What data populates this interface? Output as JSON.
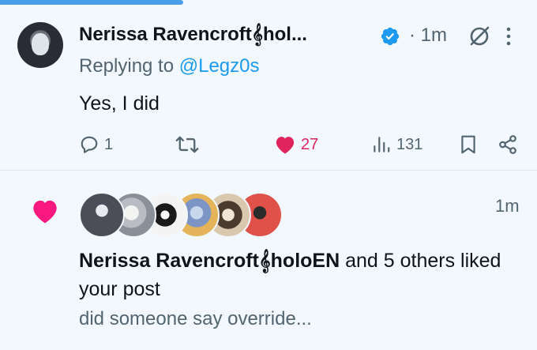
{
  "tweet": {
    "author_name": "Nerissa Ravencroft𝄞hol...",
    "verified": true,
    "separator": "·",
    "time": "1m",
    "replying_prefix": "Replying to ",
    "replying_handle": "@Legz0s",
    "text": "Yes, I did",
    "actions": {
      "reply_count": "1",
      "like_count": "27",
      "view_count": "131"
    },
    "colors": {
      "accent": "#1d9bf0",
      "like": "#e0245e"
    }
  },
  "notification": {
    "icon": "heart-icon",
    "time": "1m",
    "liker_name": "Nerissa Ravencroft𝄞holoEN",
    "liked_suffix": " and 5 others liked your post",
    "quoted_text": "did someone say override...",
    "avatar_count": 6
  }
}
